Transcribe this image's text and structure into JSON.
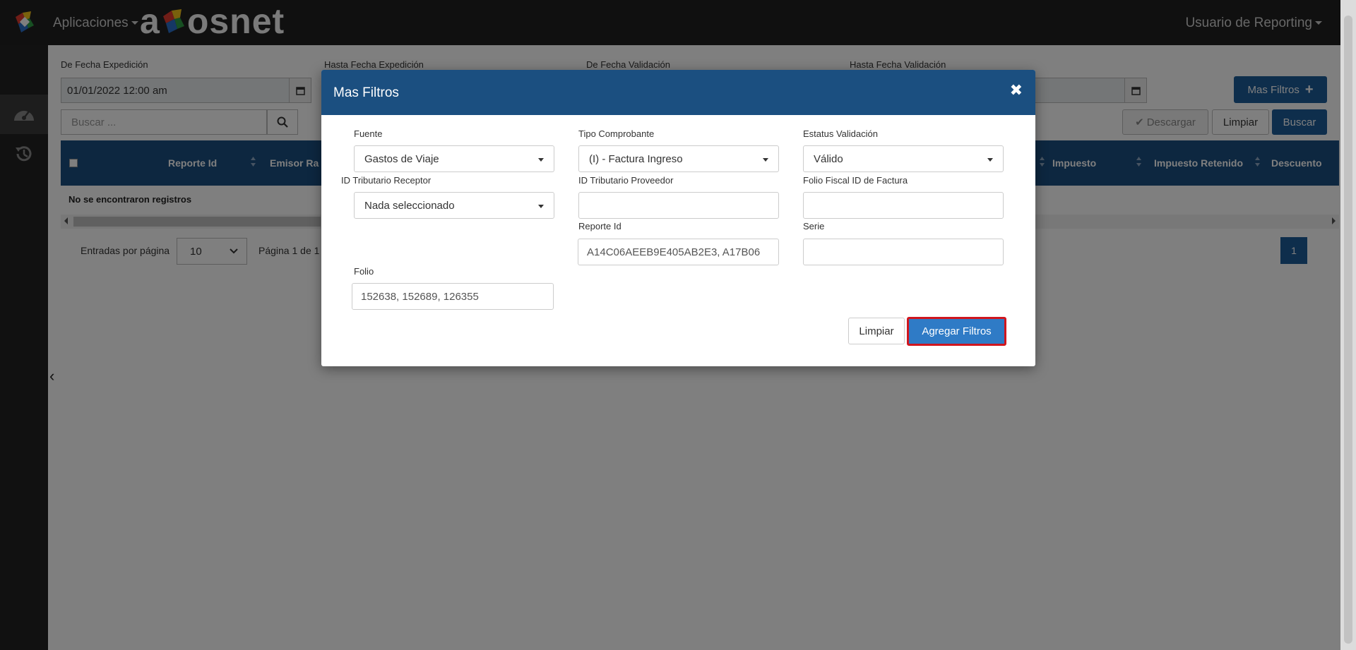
{
  "header": {
    "apps_menu": "Aplicaciones",
    "brand": "a  snet",
    "user_menu": "Usuario de Reporting"
  },
  "filters": {
    "de_fecha_expedicion_label": "De Fecha Expedición",
    "hasta_fecha_expedicion_label": "Hasta Fecha Expedición",
    "de_fecha_validacion_label": "De Fecha Validación",
    "hasta_fecha_validacion_label": "Hasta Fecha Validación",
    "de_fecha_expedicion_value": "01/01/2022 12:00 am",
    "mas_filtros_label": "Mas Filtros",
    "search_placeholder": "Buscar ...",
    "descargar_label": "Descargar",
    "limpiar_label": "Limpiar",
    "buscar_label": "Buscar"
  },
  "table": {
    "columns": [
      "Reporte Id",
      "Emisor Ra",
      "Impuesto",
      "Impuesto Retenido",
      "Descuento"
    ],
    "empty_message": "No se encontraron registros",
    "entries_label": "Entradas por página",
    "entries_value": "10",
    "page_label": "Página 1 de 1",
    "current_page": "1"
  },
  "modal": {
    "title": "Mas Filtros",
    "fuente_label": "Fuente",
    "fuente_value": "Gastos de Viaje",
    "tipo_comprobante_label": "Tipo Comprobante",
    "tipo_comprobante_value": "(I) - Factura Ingreso",
    "estatus_validacion_label": "Estatus Validación",
    "estatus_validacion_value": "Válido",
    "id_tributario_receptor_label": "ID Tributario Receptor",
    "id_tributario_receptor_value": "Nada seleccionado",
    "id_tributario_proveedor_label": "ID Tributario Proveedor",
    "id_tributario_proveedor_value": "",
    "folio_fiscal_label": "Folio Fiscal ID de Factura",
    "folio_fiscal_value": "",
    "reporte_id_label": "Reporte Id",
    "reporte_id_value": "A14C06AEEB9E405AB2E3, A17B06",
    "serie_label": "Serie",
    "serie_value": "",
    "folio_label": "Folio",
    "folio_value": "152638, 152689, 126355",
    "limpiar_label": "Limpiar",
    "agregar_label": "Agregar Filtros"
  },
  "colors": {
    "header_blue": "#1b4f80",
    "primary_blue": "#2f7bc6",
    "highlight_red": "#d0161e",
    "topbar_dark": "#202020"
  }
}
